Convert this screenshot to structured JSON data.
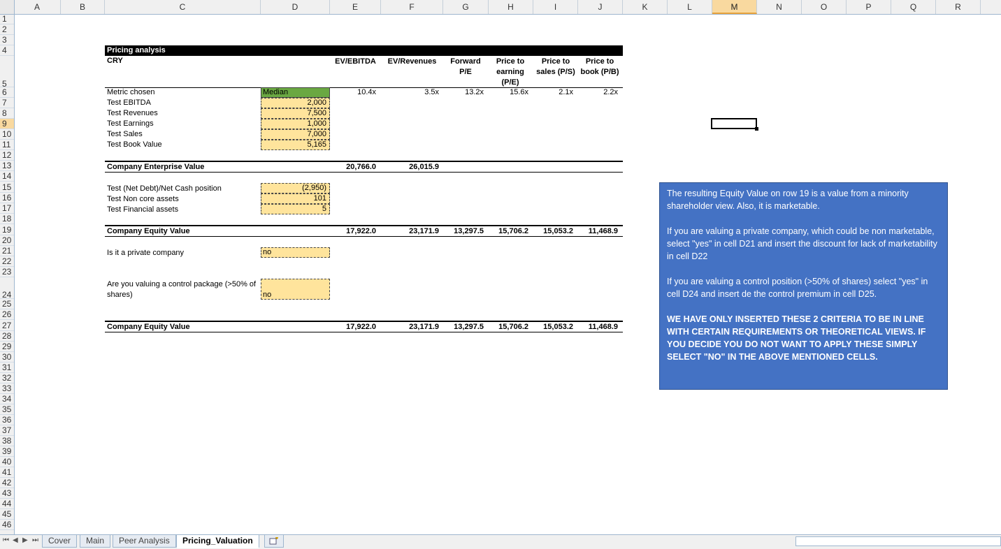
{
  "columns": [
    "A",
    "B",
    "C",
    "D",
    "E",
    "F",
    "G",
    "H",
    "I",
    "J",
    "K",
    "L",
    "M",
    "N",
    "O",
    "P",
    "Q",
    "R"
  ],
  "selected_column": "M",
  "selected_row": "9",
  "rows": [
    "1",
    "2",
    "3",
    "4",
    "5",
    "6",
    "7",
    "8",
    "9",
    "10",
    "11",
    "12",
    "13",
    "14",
    "15",
    "16",
    "17",
    "18",
    "19",
    "20",
    "21",
    "22",
    "23",
    "24",
    "25",
    "26",
    "27",
    "28",
    "29",
    "30",
    "31",
    "32",
    "33",
    "34",
    "35",
    "36",
    "37",
    "38",
    "39",
    "40",
    "41",
    "42",
    "43",
    "44",
    "45",
    "46"
  ],
  "sheet": {
    "title": "Pricing analysis",
    "company": "CRY",
    "headers": {
      "e": "EV/EBITDA",
      "f": "EV/Revenues",
      "g": "Forward P/E",
      "h": "Price to earning (P/E)",
      "i": "Price to sales (P/S)",
      "j": "Price to book (P/B)"
    },
    "metric_label": "Metric chosen",
    "metric_value": "Median",
    "multiples": [
      "10.4x",
      "3.5x",
      "13.2x",
      "15.6x",
      "2.1x",
      "2.2x"
    ],
    "tests": [
      {
        "label": "Test EBITDA",
        "value": "2,000"
      },
      {
        "label": "Test Revenues",
        "value": "7,500"
      },
      {
        "label": "Test Earnings",
        "value": "1,000"
      },
      {
        "label": "Test Sales",
        "value": "7,000"
      },
      {
        "label": "Test Book Value",
        "value": "5,165"
      }
    ],
    "ev_label": "Company Enterprise Value",
    "ev_values": [
      "20,766.0",
      "26,015.9"
    ],
    "adjustments": [
      {
        "label": "Test (Net Debt)/Net Cash position",
        "value": "(2,950)"
      },
      {
        "label": "Test Non core assets",
        "value": "101"
      },
      {
        "label": "Test Financial assets",
        "value": "5"
      }
    ],
    "equity_label": "Company Equity Value",
    "equity_values": [
      "17,922.0",
      "23,171.9",
      "13,297.5",
      "15,706.2",
      "15,053.2",
      "11,468.9"
    ],
    "private_label": "Is it a private company",
    "private_value": "no",
    "control_label_1": "Are you valuing a control package (>50% of",
    "control_label_2": "shares)",
    "control_value": "no",
    "final_label": "Company Equity Value",
    "final_values": [
      "17,922.0",
      "23,171.9",
      "13,297.5",
      "15,706.2",
      "15,053.2",
      "11,468.9"
    ]
  },
  "note": {
    "p1": "The resulting Equity Value on row 19 is a value from a minority shareholder view. Also, it is marketable.",
    "p2": "If you are valuing a private company, which could be non marketable, select \"yes\" in cell D21 and insert the discount for lack of marketability in cell D22",
    "p3": "If you are valuing a control position (>50% of shares) select \"yes\" in cell D24 and insert de the control premium in cell D25.",
    "p4": "WE HAVE ONLY INSERTED THESE 2 CRITERIA TO BE IN LINE WITH CERTAIN REQUIREMENTS OR THEORETICAL VIEWS. IF YOU DECIDE YOU DO NOT WANT TO APPLY THESE SIMPLY SELECT \"NO\" IN THE ABOVE MENTIONED CELLS."
  },
  "tabs": [
    "Cover",
    "Main",
    "Peer Analysis",
    "Pricing_Valuation"
  ],
  "active_tab": "Pricing_Valuation",
  "nav": [
    "⏮",
    "◀",
    "▶",
    "⏭"
  ]
}
